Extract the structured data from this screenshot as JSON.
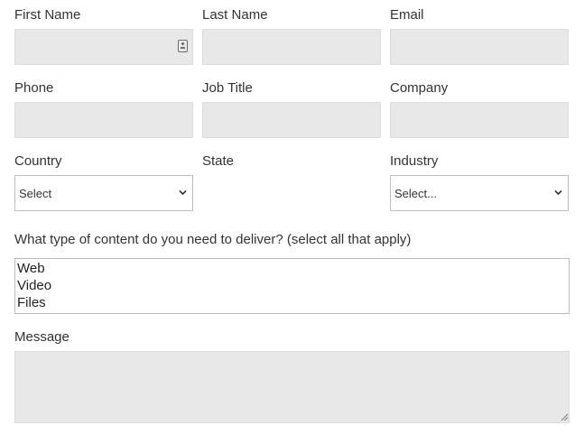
{
  "fields": {
    "first_name": {
      "label": "First Name",
      "value": ""
    },
    "last_name": {
      "label": "Last Name",
      "value": ""
    },
    "email": {
      "label": "Email",
      "value": ""
    },
    "phone": {
      "label": "Phone",
      "value": ""
    },
    "job_title": {
      "label": "Job Title",
      "value": ""
    },
    "company": {
      "label": "Company",
      "value": ""
    }
  },
  "country": {
    "label": "Country",
    "selected": "Select"
  },
  "state": {
    "label": "State"
  },
  "industry": {
    "label": "Industry",
    "selected": "Select..."
  },
  "content_type": {
    "question": "What type of content do you need to deliver? (select all that apply)",
    "options": [
      "Web",
      "Video",
      "Files"
    ]
  },
  "message": {
    "label": "Message",
    "value": ""
  },
  "icons": {
    "autofill": "contact-card-icon",
    "dropdown": "chevron-down-icon",
    "resize": "resize-grip-icon"
  }
}
